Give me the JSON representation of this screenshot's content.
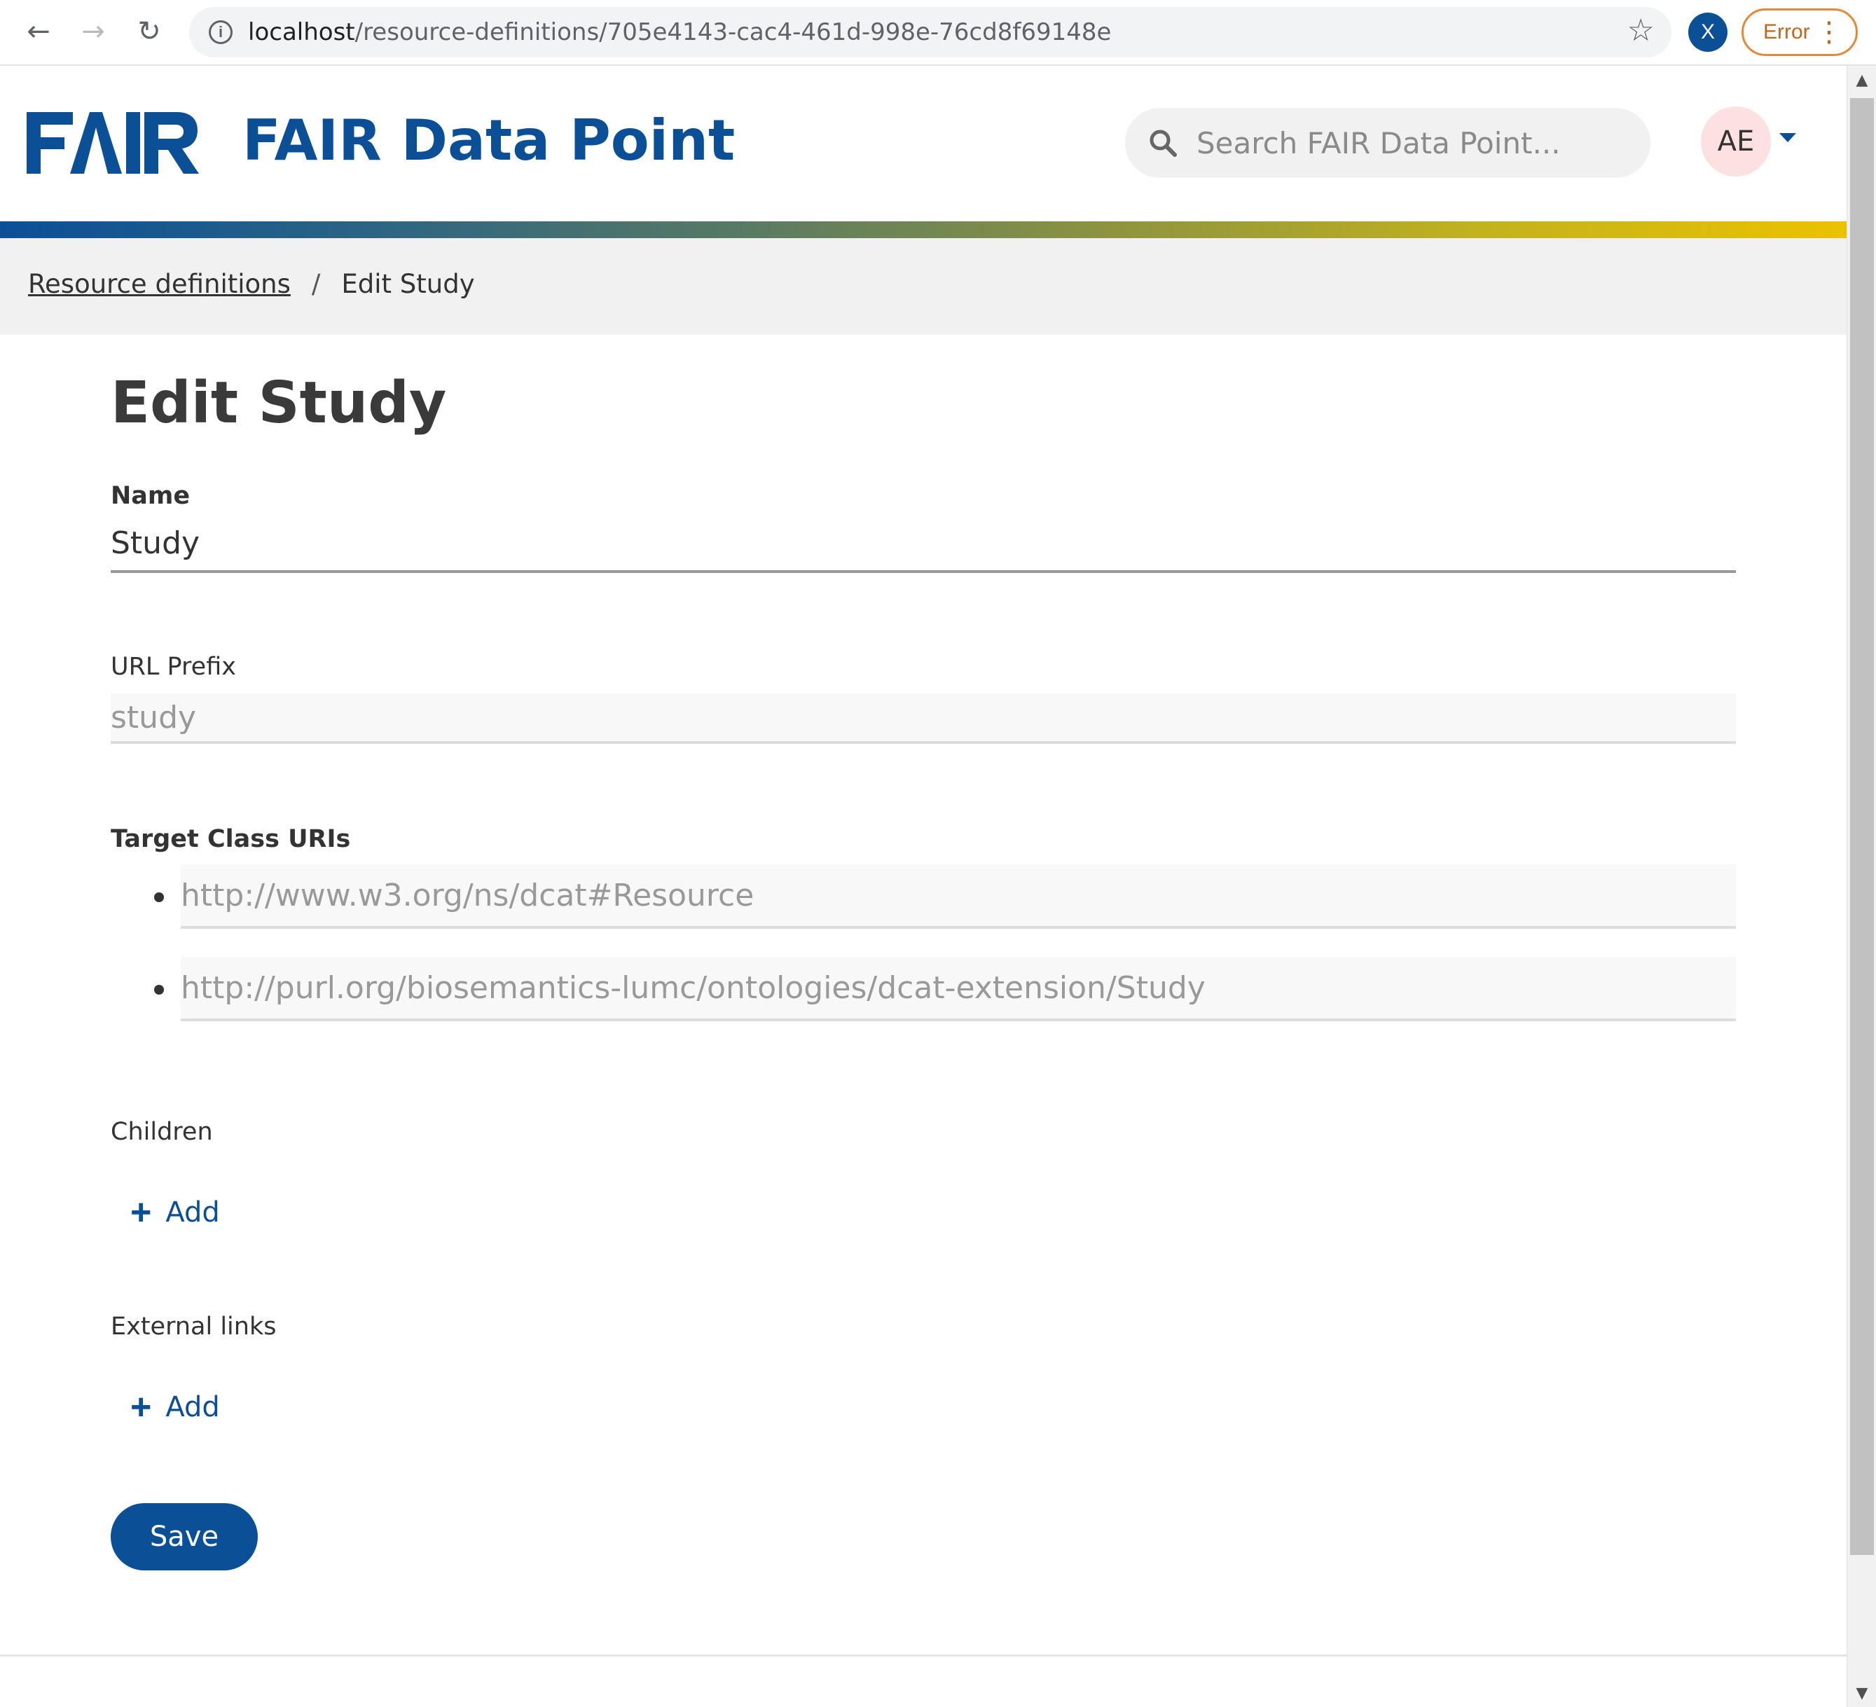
{
  "browser": {
    "url_host": "localhost",
    "url_path": "/resource-definitions/705e4143-cac4-461d-998e-76cd8f69148e",
    "profile_initial": "X",
    "error_label": "Error"
  },
  "header": {
    "logo_text": "FAIR",
    "title": "FAIR Data Point",
    "search_placeholder": "Search FAIR Data Point...",
    "avatar_initials": "AE"
  },
  "breadcrumb": {
    "link_label": "Resource definitions",
    "separator": "/",
    "current": "Edit Study"
  },
  "form": {
    "title": "Edit Study",
    "name": {
      "label": "Name",
      "value": "Study"
    },
    "url_prefix": {
      "label": "URL Prefix",
      "value": "study"
    },
    "target_class_uris": {
      "label": "Target Class URIs",
      "items": [
        "http://www.w3.org/ns/dcat#Resource",
        "http://purl.org/biosemantics-lumc/ontologies/dcat-extension/Study"
      ]
    },
    "children": {
      "label": "Children",
      "add_label": "Add"
    },
    "external_links": {
      "label": "External links",
      "add_label": "Add"
    },
    "save_label": "Save"
  },
  "colors": {
    "brand_blue": "#0b4f97",
    "gradient_end": "#ecc200",
    "error_orange": "#e8873a"
  }
}
